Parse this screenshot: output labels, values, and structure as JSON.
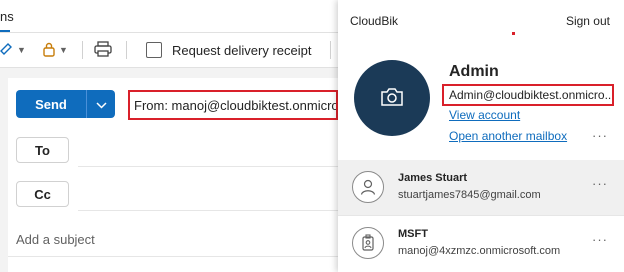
{
  "ribbon": {
    "tab_fragment": "ns"
  },
  "toolbar": {
    "request_delivery_receipt_label": "Request delivery receipt"
  },
  "compose": {
    "send_label": "Send",
    "from_text": "From: manoj@cloudbiktest.onmicrosoft.com",
    "to_label": "To",
    "cc_label": "Cc",
    "subject_placeholder": "Add a subject"
  },
  "account_panel": {
    "brand": "CloudBik",
    "sign_out_label": "Sign out",
    "current_account": {
      "name": "Admin",
      "email": "Admin@cloudbiktest.onmicro...",
      "view_account_label": "View account",
      "open_another_mailbox_label": "Open another mailbox",
      "more_label": "···"
    },
    "other_accounts": [
      {
        "name": "James Stuart",
        "email": "stuartjames7845@gmail.com",
        "more_label": "···",
        "icon": "person-icon"
      },
      {
        "name": "MSFT",
        "email": "manoj@4xzmzc.onmicrosoft.com",
        "more_label": "···",
        "icon": "badge-icon"
      }
    ]
  },
  "colors": {
    "accent": "#0f6cbd",
    "highlight_box": "#d9202a",
    "avatar_bg": "#1b3a57"
  }
}
